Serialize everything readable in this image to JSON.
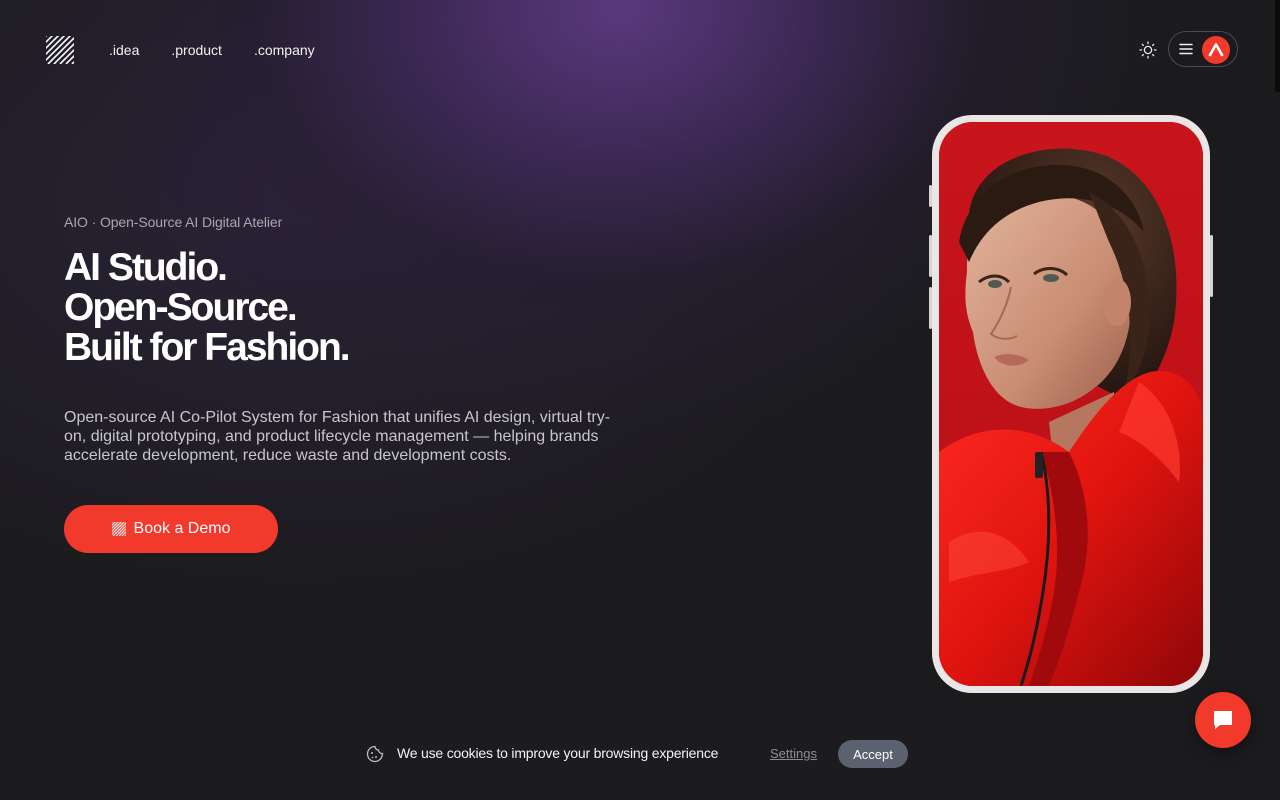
{
  "header": {
    "logo_icon": "diagonal-stripes-logo-icon",
    "nav": [
      {
        "label": ".idea"
      },
      {
        "label": ".product"
      },
      {
        "label": ".company"
      }
    ],
    "theme_icon": "sun-icon",
    "menu_icon": "hamburger-icon",
    "brand_icon": "triangle-a-icon"
  },
  "hero": {
    "eyebrow": "AIO · Open-Source AI Digital Atelier",
    "headline": [
      "AI Studio.",
      "Open-Source.",
      "Built for Fashion."
    ],
    "description": "Open-source AI Co-Pilot System for Fashion that unifies AI design, virtual try-on, digital prototyping, and product lifecycle management — helping brands accelerate development, reduce waste and development costs.",
    "cta_label": "Book a Demo",
    "cta_icon": "diagonal-stripes-icon"
  },
  "phone": {
    "image": "woman-in-red-jacket-photo"
  },
  "cookie": {
    "icon": "cookie-icon",
    "text": "We use cookies to improve your browsing experience",
    "settings_label": "Settings",
    "accept_label": "Accept"
  },
  "chat": {
    "icon": "chat-bubble-icon"
  },
  "colors": {
    "accent": "#f23a2c",
    "background": "#1b1b1d",
    "glow": "#5c3a82",
    "accept_button": "#5c6170"
  }
}
